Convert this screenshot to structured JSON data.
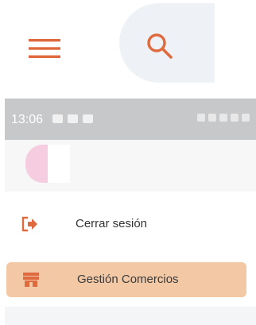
{
  "colors": {
    "accent": "#e06a3f",
    "highlight": "#f3c8a5",
    "status_bar": "#c7c8ca"
  },
  "top_bar": {
    "menu_icon": "hamburger-icon",
    "search_icon": "search-icon"
  },
  "status_bar": {
    "time": "13:06"
  },
  "drawer": {
    "items": [
      {
        "label": "Cerrar sesión",
        "icon": "logout-icon"
      },
      {
        "label": "Gestión Comercios",
        "icon": "store-icon",
        "active": true
      }
    ]
  }
}
